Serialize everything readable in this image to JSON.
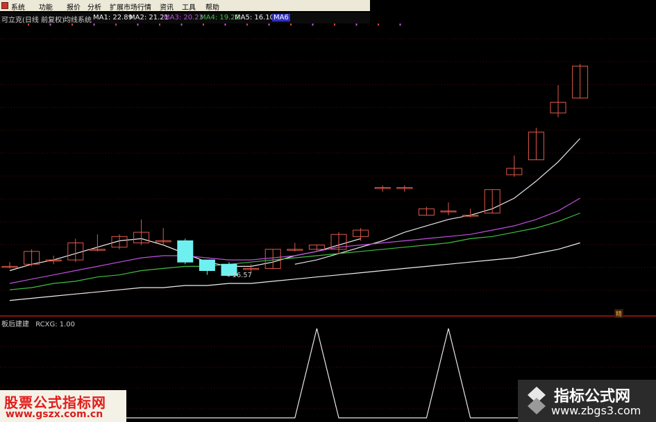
{
  "menubar": {
    "items": [
      "系统",
      "功能",
      "报价",
      "分析",
      "扩展市场行情",
      "资讯",
      "工具",
      "帮助"
    ]
  },
  "legend": {
    "stock": "可立克(日线 前复权)",
    "indicator": "均线系统",
    "ma1": "MA1: 22.89",
    "ma2": "MA2: 21.21",
    "ma3": "MA3: 20.23",
    "ma4": "MA4: 19.22",
    "ma5": "MA5: 16.10",
    "extra": "MA6"
  },
  "colors": {
    "up": "#e05a4a",
    "down": "#6ff0f0",
    "ma1": "#f0f0f0",
    "ma2": "#e8e8e8",
    "ma3": "#c050e0",
    "ma4": "#40c040",
    "ma5": "#f0f0f0",
    "separator": "#8b1010"
  },
  "price_annotation": "←16.57",
  "badge": "精",
  "indicator": {
    "name": "板后建建",
    "value": "RCXG: 1.00"
  },
  "watermark_left": {
    "line1": "股票公式指标网",
    "line2": "www.gszx.com.cn"
  },
  "watermark_right": {
    "line1": "指标公式网",
    "line2": "www.zbgs3.com"
  },
  "chart_data": {
    "type": "candlestick",
    "candles": [
      {
        "o": 17.0,
        "c": 17.0,
        "h": 17.2,
        "l": 16.9
      },
      {
        "o": 17.1,
        "c": 17.7,
        "h": 17.8,
        "l": 17.0
      },
      {
        "o": 17.3,
        "c": 17.3,
        "h": 17.5,
        "l": 17.1
      },
      {
        "o": 17.3,
        "c": 18.1,
        "h": 18.3,
        "l": 17.2
      },
      {
        "o": 17.8,
        "c": 17.8,
        "h": 18.5,
        "l": 17.7
      },
      {
        "o": 17.9,
        "c": 18.4,
        "h": 18.5,
        "l": 17.8
      },
      {
        "o": 18.1,
        "c": 18.6,
        "h": 19.2,
        "l": 18.0
      },
      {
        "o": 18.2,
        "c": 18.2,
        "h": 18.8,
        "l": 18.0
      },
      {
        "o": 18.2,
        "c": 17.2,
        "h": 18.3,
        "l": 17.1
      },
      {
        "o": 17.3,
        "c": 16.8,
        "h": 17.3,
        "l": 16.6
      },
      {
        "o": 17.1,
        "c": 16.57,
        "h": 17.2,
        "l": 16.5
      },
      {
        "o": 16.9,
        "c": 16.9,
        "h": 17.1,
        "l": 16.7
      },
      {
        "o": 16.9,
        "c": 17.8,
        "h": 17.8,
        "l": 16.9
      },
      {
        "o": 17.8,
        "c": 17.8,
        "h": 18.1,
        "l": 17.7
      },
      {
        "o": 17.8,
        "c": 18.0,
        "h": 18.0,
        "l": 17.7
      },
      {
        "o": 17.8,
        "c": 18.5,
        "h": 18.6,
        "l": 17.6
      },
      {
        "o": 18.4,
        "c": 18.7,
        "h": 18.8,
        "l": 18.2
      },
      {
        "o": 20.7,
        "c": 20.7,
        "h": 20.8,
        "l": 20.5
      },
      {
        "o": 20.7,
        "c": 20.7,
        "h": 20.8,
        "l": 20.5
      },
      {
        "o": 19.4,
        "c": 19.7,
        "h": 19.8,
        "l": 19.4
      },
      {
        "o": 19.6,
        "c": 19.6,
        "h": 20.0,
        "l": 19.4
      },
      {
        "o": 19.4,
        "c": 19.4,
        "h": 19.7,
        "l": 19.3
      },
      {
        "o": 19.5,
        "c": 20.6,
        "h": 20.6,
        "l": 19.5
      },
      {
        "o": 21.3,
        "c": 21.6,
        "h": 22.2,
        "l": 21.2
      },
      {
        "o": 22.0,
        "c": 23.3,
        "h": 23.5,
        "l": 22.0
      },
      {
        "o": 24.2,
        "c": 24.7,
        "h": 25.5,
        "l": 24.0
      },
      {
        "o": 24.9,
        "c": 26.4,
        "h": 26.5,
        "l": 24.9
      }
    ],
    "ma": [
      {
        "name": "MA1",
        "values": [
          16.8,
          17.1,
          17.3,
          17.6,
          17.9,
          18.2,
          18.3,
          18.0,
          17.6,
          17.2,
          17.0,
          17.0,
          17.2,
          17.5,
          17.7,
          18.0,
          18.3,
          null,
          null,
          null,
          null,
          null,
          null,
          null,
          null,
          null,
          null
        ]
      },
      {
        "name": "MA2",
        "values": [
          null,
          null,
          null,
          null,
          null,
          null,
          null,
          null,
          null,
          null,
          null,
          null,
          null,
          17.1,
          17.3,
          17.6,
          17.9,
          18.2,
          18.6,
          18.9,
          19.2,
          19.4,
          19.7,
          20.2,
          21.0,
          21.9,
          23.0
        ]
      },
      {
        "name": "MA3",
        "values": [
          16.2,
          16.4,
          16.6,
          16.8,
          17.0,
          17.2,
          17.4,
          17.5,
          17.5,
          17.4,
          17.3,
          17.3,
          17.4,
          17.5,
          17.7,
          17.9,
          18.0,
          18.1,
          18.2,
          18.3,
          18.4,
          18.5,
          18.7,
          18.9,
          19.2,
          19.6,
          20.2
        ]
      },
      {
        "name": "MA4",
        "values": [
          15.9,
          16.0,
          16.2,
          16.3,
          16.5,
          16.6,
          16.8,
          16.9,
          17.0,
          17.0,
          17.1,
          17.2,
          17.3,
          17.4,
          17.5,
          17.6,
          17.7,
          17.8,
          17.9,
          18.0,
          18.1,
          18.3,
          18.4,
          18.6,
          18.8,
          19.1,
          19.5
        ]
      },
      {
        "name": "MA5",
        "values": [
          15.4,
          15.5,
          15.6,
          15.7,
          15.8,
          15.9,
          16.0,
          16.0,
          16.1,
          16.1,
          16.2,
          16.2,
          16.3,
          16.4,
          16.5,
          16.6,
          16.7,
          16.8,
          16.9,
          17.0,
          17.1,
          17.2,
          17.3,
          17.4,
          17.6,
          17.8,
          18.1
        ]
      }
    ],
    "indicator_signal": [
      0,
      0,
      0,
      0,
      0,
      0,
      0,
      0,
      0,
      0,
      0,
      0,
      0,
      0,
      1,
      0,
      0,
      0,
      0,
      0,
      1,
      0,
      0,
      0,
      0,
      0,
      0
    ]
  }
}
